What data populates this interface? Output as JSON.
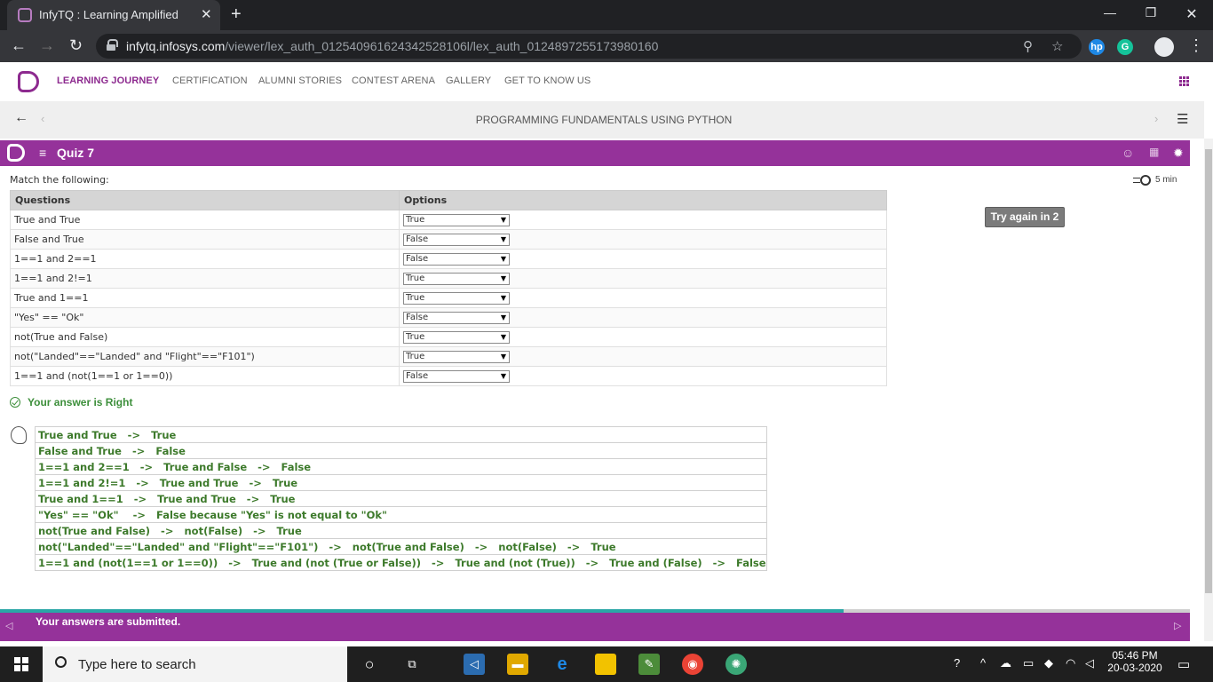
{
  "browser": {
    "tab_title": "InfyTQ : Learning Amplified",
    "url_domain": "infytq.infosys.com",
    "url_path": "/viewer/lex_auth_012540961624342528106l/lex_auth_0124897255173980160"
  },
  "site_nav": {
    "items": [
      "LEARNING JOURNEY",
      "CERTIFICATION",
      "ALUMNI STORIES",
      "CONTEST ARENA",
      "GALLERY",
      "GET TO KNOW US"
    ],
    "active": "LEARNING JOURNEY"
  },
  "course": {
    "title": "PROGRAMMING FUNDAMENTALS USING PYTHON"
  },
  "quiz": {
    "title": "Quiz 7",
    "instruction": "Match the following:",
    "timer": "5 min",
    "retry_label": "Try again in 2",
    "headers": {
      "questions": "Questions",
      "options": "Options"
    },
    "rows": [
      {
        "q": "True and True",
        "a": "True"
      },
      {
        "q": "False and True",
        "a": "False"
      },
      {
        "q": "1==1 and 2==1",
        "a": "False"
      },
      {
        "q": "1==1 and 2!=1",
        "a": "True"
      },
      {
        "q": "True and 1==1",
        "a": "True"
      },
      {
        "q": "\"Yes\" == \"Ok\"",
        "a": "False"
      },
      {
        "q": "not(True and False)",
        "a": "True"
      },
      {
        "q": "not(\"Landed\"==\"Landed\" and \"Flight\"==\"F101\")",
        "a": "True"
      },
      {
        "q": "1==1 and (not(1==1 or 1==0))",
        "a": "False"
      }
    ],
    "result": "Your answer is Right",
    "explanations": [
      "True and True   ->   True",
      "False and True   ->   False",
      "1==1 and 2==1   ->   True and False   ->   False",
      "1==1 and 2!=1   ->   True and True   ->   True",
      "True and 1==1   ->   True and True   ->   True",
      "\"Yes\" == \"Ok\"    ->   False because \"Yes\" is not equal to \"Ok\"",
      "not(True and False)   ->   not(False)   ->   True",
      "not(\"Landed\"==\"Landed\" and \"Flight\"==\"F101\")   ->   not(True and False)   ->   not(False)   ->   True",
      "1==1 and (not(1==1 or 1==0))   ->   True and (not (True or False))   ->   True and (not (True))   ->   True and (False)   ->   False"
    ],
    "submitted_msg": "Your answers are submitted."
  },
  "taskbar": {
    "search_placeholder": "Type here to search",
    "time": "05:46 PM",
    "date": "20-03-2020"
  },
  "colors": {
    "brand": "#95329a",
    "success": "#3d8f3b"
  }
}
